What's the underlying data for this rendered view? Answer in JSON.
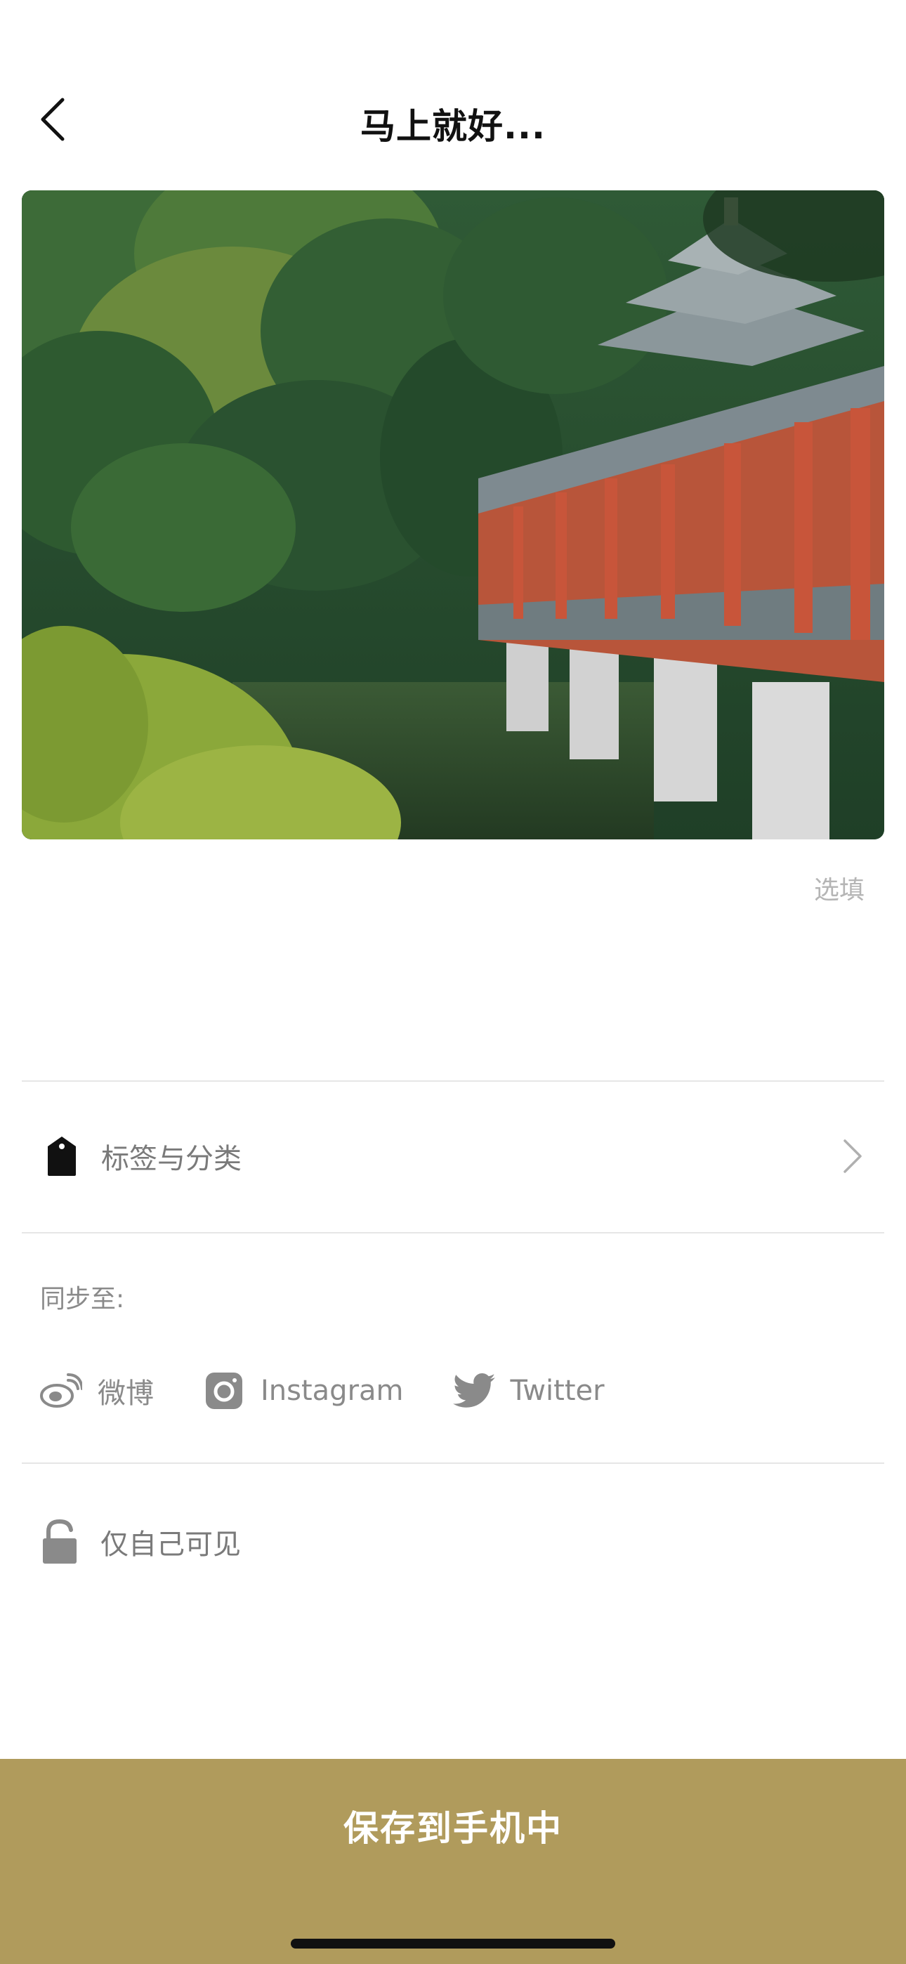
{
  "header": {
    "title": "马上就好...",
    "back_icon": "chevron-left-icon"
  },
  "post": {
    "caption_placeholder": "选填"
  },
  "tags": {
    "label": "标签与分类",
    "icon": "tag-icon"
  },
  "sync": {
    "label": "同步至:",
    "targets": [
      {
        "label": "微博",
        "icon": "weibo-icon"
      },
      {
        "label": "Instagram",
        "icon": "instagram-icon"
      },
      {
        "label": "Twitter",
        "icon": "twitter-icon"
      }
    ]
  },
  "privacy": {
    "label": "仅自己可见",
    "icon": "lock-icon"
  },
  "footer": {
    "save_label": "保存到手机中",
    "accent_color": "#b09b5c"
  }
}
